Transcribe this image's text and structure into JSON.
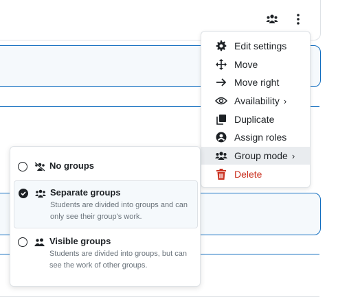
{
  "header": {
    "icons": [
      "group-mode-icon",
      "kebab-menu-icon"
    ]
  },
  "action_menu": {
    "items": [
      {
        "label": "Edit settings",
        "icon": "gear-icon"
      },
      {
        "label": "Move",
        "icon": "move-arrows-icon"
      },
      {
        "label": "Move right",
        "icon": "arrow-right-icon"
      },
      {
        "label": "Availability",
        "icon": "eye-icon",
        "submenu": true
      },
      {
        "label": "Duplicate",
        "icon": "copy-icon"
      },
      {
        "label": "Assign roles",
        "icon": "user-circle-icon"
      },
      {
        "label": "Group mode",
        "icon": "users-icon",
        "submenu": true,
        "highlighted": true
      },
      {
        "label": "Delete",
        "icon": "trash-icon",
        "danger": true
      }
    ],
    "colors": {
      "danger": "#ca3120",
      "highlight": "#e9ecef"
    }
  },
  "group_menu": {
    "options": [
      {
        "title": "No groups",
        "description": "",
        "checked": false,
        "icon": "no-groups-icon"
      },
      {
        "title": "Separate groups",
        "description": "Students are divided into groups and can only see their group's work.",
        "checked": true,
        "icon": "separate-groups-icon"
      },
      {
        "title": "Visible groups",
        "description": "Students are divided into groups, but can see the work of other groups.",
        "checked": false,
        "icon": "visible-groups-icon"
      }
    ]
  },
  "colors": {
    "accent": "#0f6cbf",
    "selected_bg": "#f5f9fc",
    "muted_text": "#6a737b"
  }
}
